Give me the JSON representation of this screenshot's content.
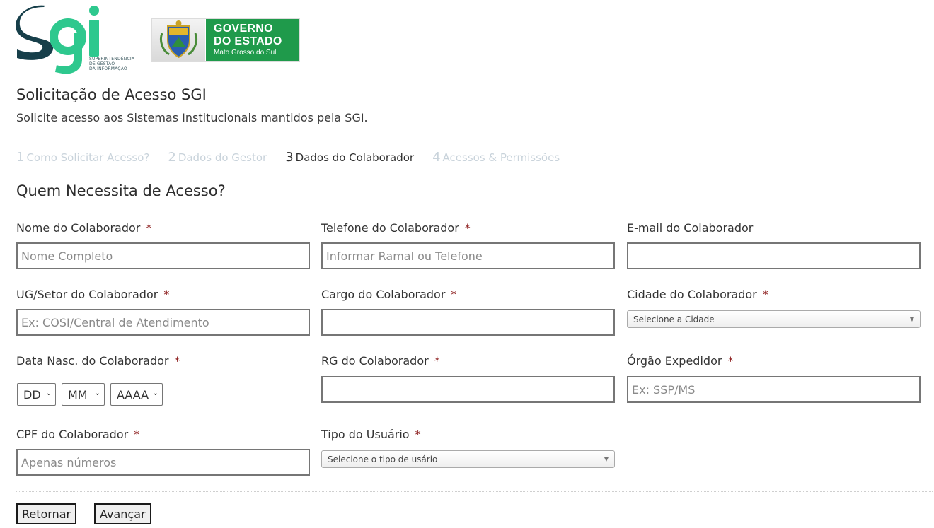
{
  "header": {
    "sgi_logo_text": "SGI",
    "sgi_tagline": [
      "SUPERINTENDÊNCIA",
      "DE GESTÃO",
      "DA INFORMAÇÃO"
    ],
    "gov_line1": "GOVERNO",
    "gov_line2": "DO ESTADO",
    "gov_line3": "Mato Grosso do Sul"
  },
  "page": {
    "title": "Solicitação de Acesso SGI",
    "subtitle": "Solicite acesso aos Sistemas Institucionais mantidos pela SGI."
  },
  "steps": [
    {
      "num": "1",
      "label": "Como Solicitar Acesso?",
      "active": false
    },
    {
      "num": "2",
      "label": "Dados do Gestor",
      "active": false
    },
    {
      "num": "3",
      "label": "Dados do Colaborador",
      "active": true
    },
    {
      "num": "4",
      "label": "Acessos & Permissões",
      "active": false
    }
  ],
  "section_title": "Quem Necessita de Acesso?",
  "required_mark": "*",
  "form": {
    "nome": {
      "label": "Nome do Colaborador",
      "placeholder": "Nome Completo",
      "value": ""
    },
    "telefone": {
      "label": "Telefone do Colaborador",
      "placeholder": "Informar Ramal ou Telefone",
      "value": ""
    },
    "email": {
      "label": "E-mail do Colaborador",
      "placeholder": "",
      "value": ""
    },
    "ug_setor": {
      "label": "UG/Setor do Colaborador",
      "placeholder": "Ex: COSI/Central de Atendimento",
      "value": ""
    },
    "cargo": {
      "label": "Cargo do Colaborador",
      "placeholder": "",
      "value": ""
    },
    "cidade": {
      "label": "Cidade do Colaborador",
      "selected": "Selecione a Cidade"
    },
    "data_nasc": {
      "label": "Data Nasc. do Colaborador",
      "day": "DD",
      "month": "MM",
      "year": "AAAA"
    },
    "rg": {
      "label": "RG do Colaborador",
      "placeholder": "",
      "value": ""
    },
    "orgao": {
      "label": "Órgão Expedidor",
      "placeholder": "Ex: SSP/MS",
      "value": ""
    },
    "cpf": {
      "label": "CPF do Colaborador",
      "placeholder": "Apenas números",
      "value": ""
    },
    "tipo_usuario": {
      "label": "Tipo do Usuário",
      "selected": "Selecione o tipo de usário"
    }
  },
  "buttons": {
    "back": "Retornar",
    "next": "Avançar"
  },
  "colors": {
    "sgi_dark": "#173f4a",
    "sgi_green": "#2ec88e",
    "gov_green": "#1f9a4b",
    "required": "#8b1a1a"
  }
}
